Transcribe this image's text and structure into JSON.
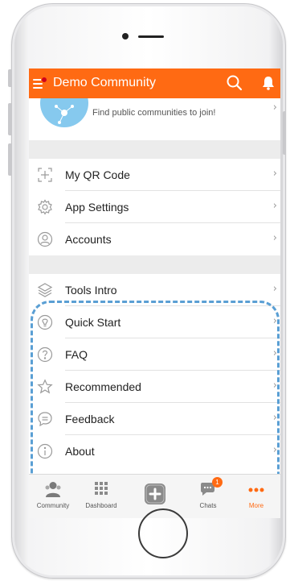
{
  "app": {
    "title": "Demo Community"
  },
  "discover": {
    "text": "Find public communities to join!"
  },
  "settings_group": [
    {
      "label": "My QR Code",
      "icon": "qr-code-icon"
    },
    {
      "label": "App Settings",
      "icon": "gear-icon"
    },
    {
      "label": "Accounts",
      "icon": "user-circle-icon"
    }
  ],
  "help_group": [
    {
      "label": "Tools Intro",
      "icon": "layers-icon"
    },
    {
      "label": "Quick Start",
      "icon": "lightbulb-icon"
    },
    {
      "label": "FAQ",
      "icon": "question-circle-icon"
    },
    {
      "label": "Recommended",
      "icon": "star-icon"
    },
    {
      "label": "Feedback",
      "icon": "chat-bubble-icon"
    },
    {
      "label": "About",
      "icon": "info-circle-icon"
    }
  ],
  "tabs": [
    {
      "label": "Community",
      "icon": "people-icon",
      "active": false
    },
    {
      "label": "Dashboard",
      "icon": "grid-icon",
      "active": false
    },
    {
      "label": "",
      "icon": "plus-icon",
      "active": false
    },
    {
      "label": "Chats",
      "icon": "chats-icon",
      "badge": "1",
      "active": false
    },
    {
      "label": "More",
      "icon": "more-dots-icon",
      "active": true
    }
  ],
  "colors": {
    "accent": "#ff6a13",
    "highlight": "#5a9fd4",
    "badge": "#ff6a13"
  }
}
